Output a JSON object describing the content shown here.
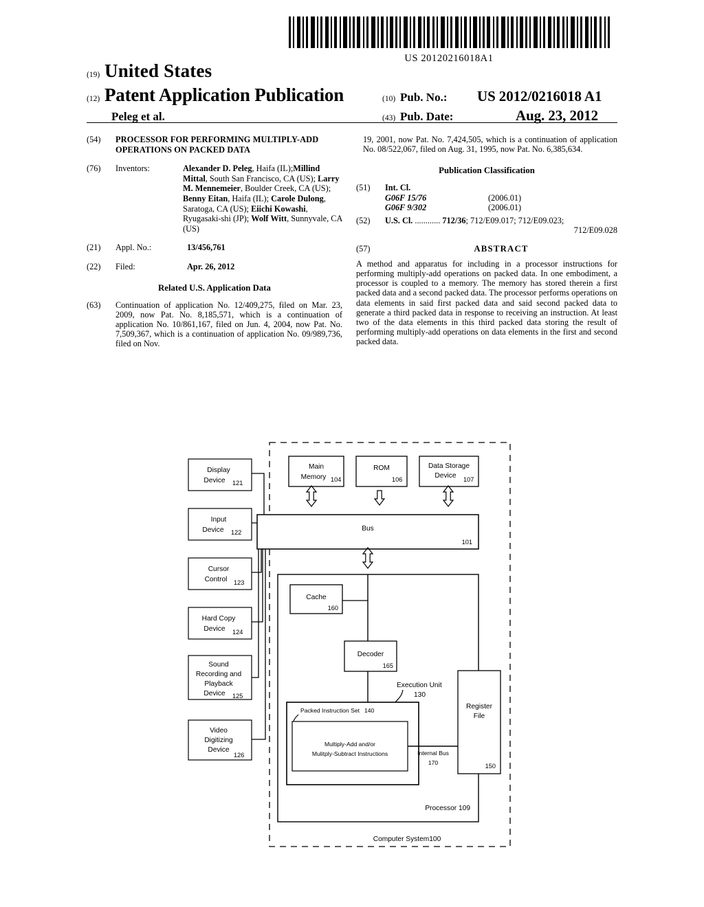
{
  "barcode": {
    "number": "US 20120216018A1"
  },
  "masthead": {
    "code19": "(19)",
    "country": "United States",
    "code12": "(12)",
    "doc_type": "Patent Application Publication",
    "authors": "Peleg et al.",
    "code10": "(10)",
    "pub_no_label": "Pub. No.:",
    "pub_no_value": "US 2012/0216018 A1",
    "code43": "(43)",
    "pub_date_label": "Pub. Date:",
    "pub_date_value": "Aug. 23, 2012"
  },
  "left": {
    "title_num": "(54)",
    "title": "PROCESSOR FOR PERFORMING MULTIPLY-ADD OPERATIONS ON PACKED DATA",
    "inventors_num": "(76)",
    "inventors_label": "Inventors:",
    "inventors": [
      {
        "name": "Alexander D. Peleg",
        "rest": ", Haifa (IL);"
      },
      {
        "name": "Millind Mittal",
        "rest": ", South San Francisco, CA (US); "
      },
      {
        "name": "Larry M. Mennemeier",
        "rest": ", Boulder Creek, CA (US); "
      },
      {
        "name": "Benny Eitan",
        "rest": ", Haifa (IL); "
      },
      {
        "name": "Carole Dulong",
        "rest": ", Saratoga, CA (US); "
      },
      {
        "name": "Eiichi Kowashi",
        "rest": ", Ryugasaki-shi (JP); "
      },
      {
        "name": "Wolf Witt",
        "rest": ", Sunnyvale, CA (US)"
      }
    ],
    "appl_num": "(21)",
    "appl_label": "Appl. No.:",
    "appl_value": "13/456,761",
    "filed_num": "(22)",
    "filed_label": "Filed:",
    "filed_value": "Apr. 26, 2012",
    "related_head": "Related U.S. Application Data",
    "related_num": "(63)",
    "related_text": "Continuation of application No. 12/409,275, filed on Mar. 23, 2009, now Pat. No. 8,185,571, which is a continuation of application No. 10/861,167, filed on Jun. 4, 2004, now Pat. No. 7,509,367, which is a continuation of application No. 09/989,736, filed on Nov."
  },
  "right": {
    "continuation_text": "19, 2001, now Pat. No. 7,424,505, which is a continuation of application No. 08/522,067, filed on Aug. 31, 1995, now Pat. No. 6,385,634.",
    "classification_head": "Publication Classification",
    "intcl_num": "(51)",
    "intcl_label": "Int. Cl.",
    "intcl_rows": [
      {
        "code": "G06F  15/76",
        "version": "(2006.01)"
      },
      {
        "code": "G06F  9/302",
        "version": "(2006.01)"
      }
    ],
    "uscl_num": "(52)",
    "uscl_line1": "U.S. Cl. ............ 712/36; 712/E09.017; 712/E09.023;",
    "uscl_line1_bold": "U.S. Cl.",
    "uscl_dots": " ............ ",
    "uscl_primary": "712/36",
    "uscl_rest": "; 712/E09.017; 712/E09.023;",
    "uscl_line2": "712/E09.028",
    "abstract_num": "(57)",
    "abstract_head": "ABSTRACT",
    "abstract_text": "A method and apparatus for including in a processor instructions for performing multiply-add operations on packed data. In one embodiment, a processor is coupled to a memory. The memory has stored therein a first packed data and a second packed data. The processor performs operations on data elements in said first packed data and said second packed data to generate a third packed data in response to receiving an instruction. At least two of the data elements in this third packed data storing the result of performing multiply-add operations on data elements in the first and second packed data."
  },
  "figure": {
    "peripherals": [
      {
        "lines": [
          "Display",
          "Device"
        ],
        "ref": "121"
      },
      {
        "lines": [
          "Input",
          "Device"
        ],
        "ref": "122"
      },
      {
        "lines": [
          "Cursor",
          "Control"
        ],
        "ref": "123"
      },
      {
        "lines": [
          "Hard Copy",
          "Device"
        ],
        "ref": "124"
      },
      {
        "lines": [
          "Sound",
          "Recording and",
          "Playback",
          "Device"
        ],
        "ref": "125"
      },
      {
        "lines": [
          "Video",
          "Digitizing",
          "Device"
        ],
        "ref": "126"
      }
    ],
    "main_memory": {
      "line1": "Main",
      "line2": "Memory",
      "ref": "104"
    },
    "rom": {
      "label": "ROM",
      "ref": "106"
    },
    "data_storage": {
      "line1": "Data Storage",
      "line2": "Device",
      "ref": "107"
    },
    "bus": {
      "label": "Bus",
      "ref": "101"
    },
    "cache": {
      "label": "Cache",
      "ref": "160"
    },
    "decoder": {
      "label": "Decoder",
      "ref": "165"
    },
    "execution_unit": {
      "line1": "Execution Unit",
      "ref": "130"
    },
    "packed_instruction_set": {
      "label": "Packed Instruction Set",
      "ref": "140"
    },
    "instructions": {
      "line1": "Multiply-Add and/or",
      "line2": "Mulitply-Subtract Instructions"
    },
    "internal_bus": {
      "label": "Internal Bus",
      "ref": "170"
    },
    "register_file": {
      "line1": "Register",
      "line2": "File",
      "ref": "150"
    },
    "processor_label": "Processor 109",
    "system_label": "Computer System100"
  }
}
